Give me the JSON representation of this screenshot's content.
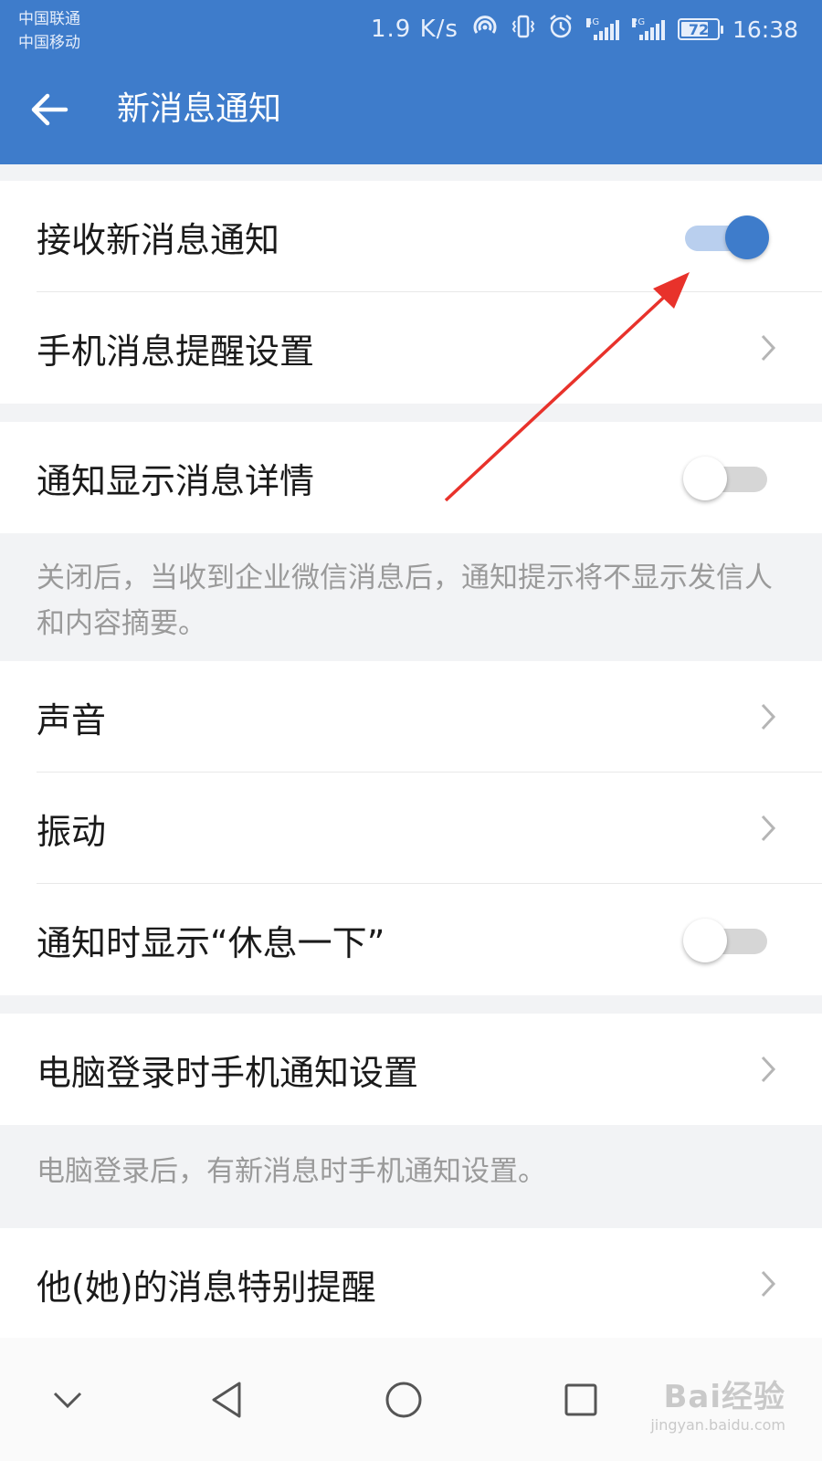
{
  "status_bar": {
    "carrier_1": "中国联通",
    "carrier_2": "中国移动",
    "speed": "1.9 K/s",
    "net_1": "4G",
    "net_2": "2G",
    "battery": "72",
    "time": "16:38"
  },
  "header": {
    "title": "新消息通知",
    "back_icon": "arrow-left-icon"
  },
  "settings": {
    "receive_new": {
      "label": "接收新消息通知",
      "toggle": true
    },
    "phone_reminder": {
      "label": "手机消息提醒设置"
    },
    "show_details": {
      "label": "通知显示消息详情",
      "toggle": false
    },
    "show_details_note": "关闭后，当收到企业微信消息后，通知提示将不显示发信人和内容摘要。",
    "sound": {
      "label": "声音"
    },
    "vibration": {
      "label": "振动"
    },
    "take_break": {
      "label": "通知时显示“休息一下”",
      "toggle": false
    },
    "pc_login": {
      "label": "电脑登录时手机通知设置"
    },
    "pc_login_note": "电脑登录后，有新消息时手机通知设置。",
    "special_reminder": {
      "label": "他(她)的消息特别提醒"
    }
  },
  "nav_bar": {
    "icons": [
      "chevron-down-icon",
      "back-triangle-icon",
      "home-circle-icon",
      "recents-square-icon"
    ]
  },
  "colors": {
    "primary": "#3e7ccb",
    "annotation_arrow": "#e8322b"
  },
  "watermark": {
    "top": "Bai经验",
    "bottom": "jingyan.baidu.com"
  }
}
